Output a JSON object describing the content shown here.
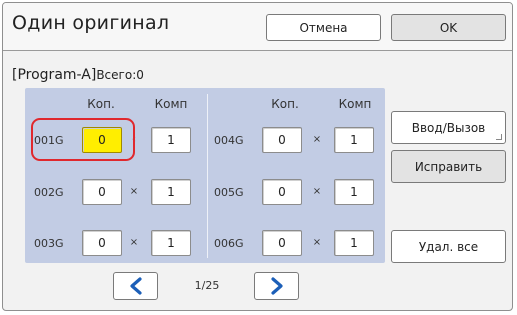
{
  "header": {
    "title": "Один оригинал",
    "cancel_label": "Отмена",
    "ok_label": "OK"
  },
  "program": {
    "name": "[Program-A]",
    "total": "Всего:0"
  },
  "columns": {
    "copies": "Коп.",
    "sets": "Комп"
  },
  "rows": [
    {
      "label": "001G",
      "copies": "0",
      "sets": "1",
      "sep": "‹",
      "active": true
    },
    {
      "label": "002G",
      "copies": "0",
      "sets": "1",
      "sep": "×",
      "active": false
    },
    {
      "label": "003G",
      "copies": "0",
      "sets": "1",
      "sep": "×",
      "active": false
    },
    {
      "label": "004G",
      "copies": "0",
      "sets": "1",
      "sep": "×",
      "active": false
    },
    {
      "label": "005G",
      "copies": "0",
      "sets": "1",
      "sep": "×",
      "active": false
    },
    {
      "label": "006G",
      "copies": "0",
      "sets": "1",
      "sep": "×",
      "active": false
    }
  ],
  "side_buttons": {
    "enter_call": "Ввод/Вызов",
    "edit": "Исправить",
    "delete_all": "Удал. все"
  },
  "pagination": {
    "page": "1/25",
    "prev_icon": "chevron-left-icon",
    "next_icon": "chevron-right-icon"
  },
  "colors": {
    "accent_blue": "#1c5fb8",
    "panel_bg": "#c2cce4",
    "active_field": "#ffee00",
    "highlight_ring": "#e0282d"
  }
}
